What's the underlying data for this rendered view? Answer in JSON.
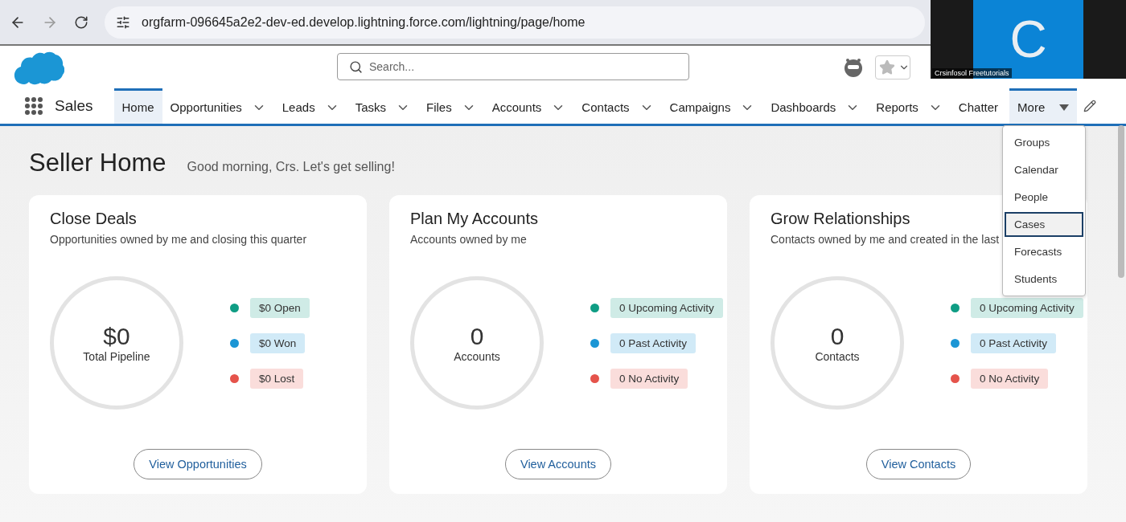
{
  "browser": {
    "url": "orgfarm-096645a2e2-dev-ed.develop.lightning.force.com/lightning/page/home"
  },
  "header": {
    "search": {
      "placeholder": "Search..."
    }
  },
  "nav": {
    "app_name": "Sales",
    "tabs": [
      {
        "label": "Home",
        "kind": "plain",
        "selected": true
      },
      {
        "label": "Opportunities",
        "kind": "menu",
        "selected": false
      },
      {
        "label": "Leads",
        "kind": "menu",
        "selected": false
      },
      {
        "label": "Tasks",
        "kind": "menu",
        "selected": false
      },
      {
        "label": "Files",
        "kind": "menu",
        "selected": false
      },
      {
        "label": "Accounts",
        "kind": "menu",
        "selected": false
      },
      {
        "label": "Contacts",
        "kind": "menu",
        "selected": false
      },
      {
        "label": "Campaigns",
        "kind": "menu",
        "selected": false
      },
      {
        "label": "Dashboards",
        "kind": "menu",
        "selected": false
      },
      {
        "label": "Reports",
        "kind": "menu",
        "selected": false
      },
      {
        "label": "Chatter",
        "kind": "plain",
        "selected": false
      }
    ],
    "more": {
      "label": "More",
      "expanded": true,
      "items": [
        {
          "label": "Groups",
          "selected": false
        },
        {
          "label": "Calendar",
          "selected": false
        },
        {
          "label": "People",
          "selected": false
        },
        {
          "label": "Cases",
          "selected": true
        },
        {
          "label": "Forecasts",
          "selected": false
        },
        {
          "label": "Students",
          "selected": false
        }
      ]
    }
  },
  "video_tile": {
    "initial": "C",
    "name": "Crsinfosol Freetutorials"
  },
  "page": {
    "title": "Seller Home",
    "greeting": "Good morning, Crs. Let's get selling!"
  },
  "cards": [
    {
      "title": "Close Deals",
      "subtitle": "Opportunities owned by me and closing this quarter",
      "total": "$0",
      "total_label": "Total Pipeline",
      "button": "View Opportunities",
      "legend": [
        {
          "label": "$0 Open",
          "color": "#0f9d84"
        },
        {
          "label": "$0 Won",
          "color": "#1b96d5"
        },
        {
          "label": "$0 Lost",
          "color": "#e5534b"
        }
      ]
    },
    {
      "title": "Plan My Accounts",
      "subtitle": "Accounts owned by me",
      "total": "0",
      "total_label": "Accounts",
      "button": "View Accounts",
      "legend": [
        {
          "label": "0 Upcoming Activity",
          "color": "#0f9d84"
        },
        {
          "label": "0 Past Activity",
          "color": "#1b96d5"
        },
        {
          "label": "0 No Activity",
          "color": "#e5534b"
        }
      ]
    },
    {
      "title": "Grow Relationships",
      "subtitle": "Contacts owned by me and created in the last",
      "total": "0",
      "total_label": "Contacts",
      "button": "View Contacts",
      "legend": [
        {
          "label": "0 Upcoming Activity",
          "color": "#0f9d84"
        },
        {
          "label": "0 Past Activity",
          "color": "#1b96d5"
        },
        {
          "label": "0 No Activity",
          "color": "#e5534b"
        }
      ]
    }
  ]
}
